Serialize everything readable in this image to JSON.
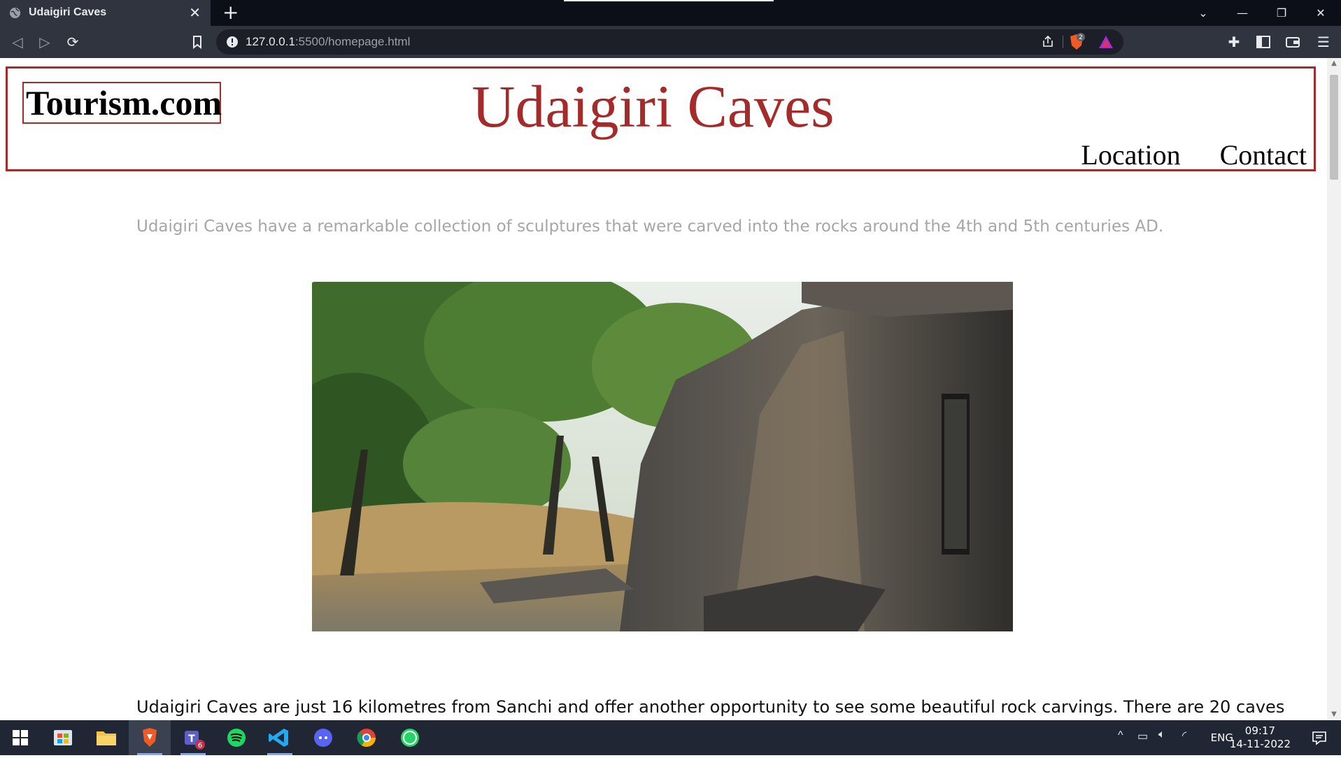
{
  "browser": {
    "tab_title": "Udaigiri Caves",
    "url_host": "127.0.0.1",
    "url_path": ":5500/homepage.html",
    "shield_count": "2"
  },
  "site": {
    "logo": "Tourism.com",
    "title": "Udaigiri Caves",
    "nav": [
      "Location",
      "Contact"
    ],
    "intro": "Udaigiri Caves have a remarkable collection of sculptures that were carved into the rocks around the 4th and 5th centuries AD.",
    "body_text": "Udaigiri Caves are just 16 kilometres from Sanchi and offer another opportunity to see some beautiful rock carvings. There are 20 caves",
    "hero_image": "cave-landscape-photo"
  },
  "taskbar": {
    "apps": [
      "windows-start-icon",
      "store-icon",
      "file-explorer-icon",
      "brave-icon",
      "teams-icon",
      "spotify-icon",
      "vscode-icon",
      "discord-icon",
      "chrome-dev-icon",
      "whatsapp-icon"
    ],
    "teams_badge": "6",
    "lang": "ENG",
    "time": "09:17",
    "date": "14-11-2022"
  },
  "colors": {
    "accent": "#a52a2a",
    "intro_text": "#a6a6a6",
    "chrome_bg": "#30343f",
    "taskbar_bg": "#202634"
  }
}
